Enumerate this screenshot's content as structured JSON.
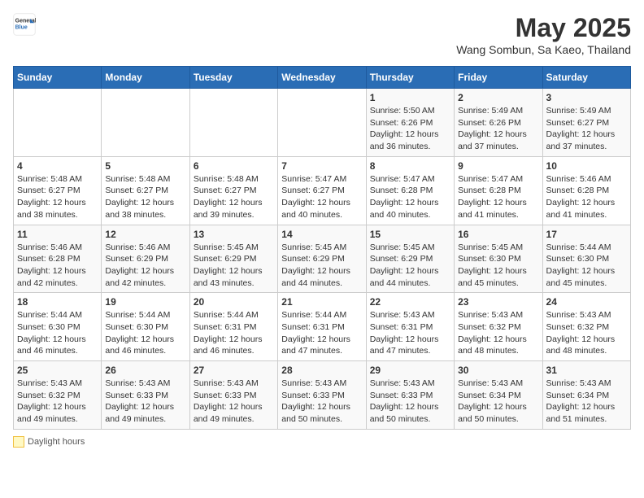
{
  "header": {
    "logo": {
      "general": "General",
      "blue": "Blue"
    },
    "title": "May 2025",
    "subtitle": "Wang Sombun, Sa Kaeo, Thailand"
  },
  "days_of_week": [
    "Sunday",
    "Monday",
    "Tuesday",
    "Wednesday",
    "Thursday",
    "Friday",
    "Saturday"
  ],
  "weeks": [
    [
      {
        "day": "",
        "info": ""
      },
      {
        "day": "",
        "info": ""
      },
      {
        "day": "",
        "info": ""
      },
      {
        "day": "",
        "info": ""
      },
      {
        "day": "1",
        "info": "Sunrise: 5:50 AM\nSunset: 6:26 PM\nDaylight: 12 hours\nand 36 minutes."
      },
      {
        "day": "2",
        "info": "Sunrise: 5:49 AM\nSunset: 6:26 PM\nDaylight: 12 hours\nand 37 minutes."
      },
      {
        "day": "3",
        "info": "Sunrise: 5:49 AM\nSunset: 6:27 PM\nDaylight: 12 hours\nand 37 minutes."
      }
    ],
    [
      {
        "day": "4",
        "info": "Sunrise: 5:48 AM\nSunset: 6:27 PM\nDaylight: 12 hours\nand 38 minutes."
      },
      {
        "day": "5",
        "info": "Sunrise: 5:48 AM\nSunset: 6:27 PM\nDaylight: 12 hours\nand 38 minutes."
      },
      {
        "day": "6",
        "info": "Sunrise: 5:48 AM\nSunset: 6:27 PM\nDaylight: 12 hours\nand 39 minutes."
      },
      {
        "day": "7",
        "info": "Sunrise: 5:47 AM\nSunset: 6:27 PM\nDaylight: 12 hours\nand 40 minutes."
      },
      {
        "day": "8",
        "info": "Sunrise: 5:47 AM\nSunset: 6:28 PM\nDaylight: 12 hours\nand 40 minutes."
      },
      {
        "day": "9",
        "info": "Sunrise: 5:47 AM\nSunset: 6:28 PM\nDaylight: 12 hours\nand 41 minutes."
      },
      {
        "day": "10",
        "info": "Sunrise: 5:46 AM\nSunset: 6:28 PM\nDaylight: 12 hours\nand 41 minutes."
      }
    ],
    [
      {
        "day": "11",
        "info": "Sunrise: 5:46 AM\nSunset: 6:28 PM\nDaylight: 12 hours\nand 42 minutes."
      },
      {
        "day": "12",
        "info": "Sunrise: 5:46 AM\nSunset: 6:29 PM\nDaylight: 12 hours\nand 42 minutes."
      },
      {
        "day": "13",
        "info": "Sunrise: 5:45 AM\nSunset: 6:29 PM\nDaylight: 12 hours\nand 43 minutes."
      },
      {
        "day": "14",
        "info": "Sunrise: 5:45 AM\nSunset: 6:29 PM\nDaylight: 12 hours\nand 44 minutes."
      },
      {
        "day": "15",
        "info": "Sunrise: 5:45 AM\nSunset: 6:29 PM\nDaylight: 12 hours\nand 44 minutes."
      },
      {
        "day": "16",
        "info": "Sunrise: 5:45 AM\nSunset: 6:30 PM\nDaylight: 12 hours\nand 45 minutes."
      },
      {
        "day": "17",
        "info": "Sunrise: 5:44 AM\nSunset: 6:30 PM\nDaylight: 12 hours\nand 45 minutes."
      }
    ],
    [
      {
        "day": "18",
        "info": "Sunrise: 5:44 AM\nSunset: 6:30 PM\nDaylight: 12 hours\nand 46 minutes."
      },
      {
        "day": "19",
        "info": "Sunrise: 5:44 AM\nSunset: 6:30 PM\nDaylight: 12 hours\nand 46 minutes."
      },
      {
        "day": "20",
        "info": "Sunrise: 5:44 AM\nSunset: 6:31 PM\nDaylight: 12 hours\nand 46 minutes."
      },
      {
        "day": "21",
        "info": "Sunrise: 5:44 AM\nSunset: 6:31 PM\nDaylight: 12 hours\nand 47 minutes."
      },
      {
        "day": "22",
        "info": "Sunrise: 5:43 AM\nSunset: 6:31 PM\nDaylight: 12 hours\nand 47 minutes."
      },
      {
        "day": "23",
        "info": "Sunrise: 5:43 AM\nSunset: 6:32 PM\nDaylight: 12 hours\nand 48 minutes."
      },
      {
        "day": "24",
        "info": "Sunrise: 5:43 AM\nSunset: 6:32 PM\nDaylight: 12 hours\nand 48 minutes."
      }
    ],
    [
      {
        "day": "25",
        "info": "Sunrise: 5:43 AM\nSunset: 6:32 PM\nDaylight: 12 hours\nand 49 minutes."
      },
      {
        "day": "26",
        "info": "Sunrise: 5:43 AM\nSunset: 6:33 PM\nDaylight: 12 hours\nand 49 minutes."
      },
      {
        "day": "27",
        "info": "Sunrise: 5:43 AM\nSunset: 6:33 PM\nDaylight: 12 hours\nand 49 minutes."
      },
      {
        "day": "28",
        "info": "Sunrise: 5:43 AM\nSunset: 6:33 PM\nDaylight: 12 hours\nand 50 minutes."
      },
      {
        "day": "29",
        "info": "Sunrise: 5:43 AM\nSunset: 6:33 PM\nDaylight: 12 hours\nand 50 minutes."
      },
      {
        "day": "30",
        "info": "Sunrise: 5:43 AM\nSunset: 6:34 PM\nDaylight: 12 hours\nand 50 minutes."
      },
      {
        "day": "31",
        "info": "Sunrise: 5:43 AM\nSunset: 6:34 PM\nDaylight: 12 hours\nand 51 minutes."
      }
    ]
  ],
  "legend": {
    "daylight_label": "Daylight hours"
  }
}
